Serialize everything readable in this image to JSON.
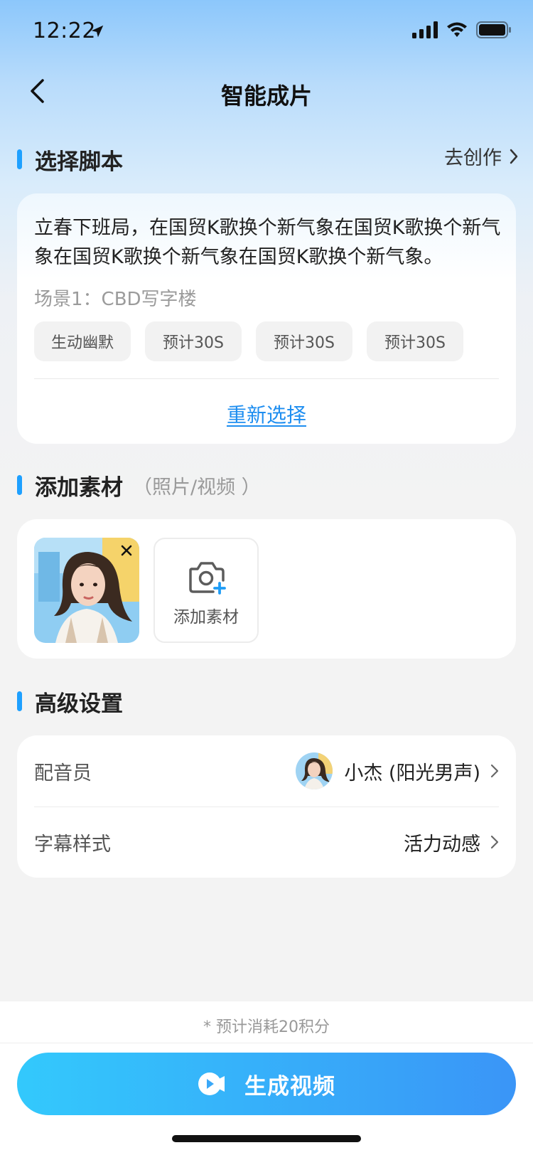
{
  "status_bar": {
    "time": "12:22"
  },
  "nav": {
    "title": "智能成片"
  },
  "script_section": {
    "title": "选择脚本",
    "action_label": "去创作",
    "script_text": "立春下班局，在国贸K歌换个新气象在国贸K歌换个新气象在国贸K歌换个新气象在国贸K歌换个新气象。",
    "scene": "场景1：CBD写字楼",
    "tags": [
      "生动幽默",
      "预计30S",
      "预计30S",
      "预计30S"
    ],
    "reselect_label": "重新选择"
  },
  "material_section": {
    "title": "添加素材",
    "subtitle": "（照片/视频 ）",
    "add_label": "添加素材"
  },
  "advanced_section": {
    "title": "高级设置",
    "rows": [
      {
        "label": "配音员",
        "value": "小杰 (阳光男声)"
      },
      {
        "label": "字幕样式",
        "value": "活力动感"
      }
    ]
  },
  "bottom": {
    "hint": "* 预计消耗20积分",
    "generate_label": "生成视频"
  },
  "colors": {
    "accent": "#1ea0ff",
    "link": "#1e8ef0",
    "button_start": "#33c9fc",
    "button_end": "#3a95f7"
  }
}
